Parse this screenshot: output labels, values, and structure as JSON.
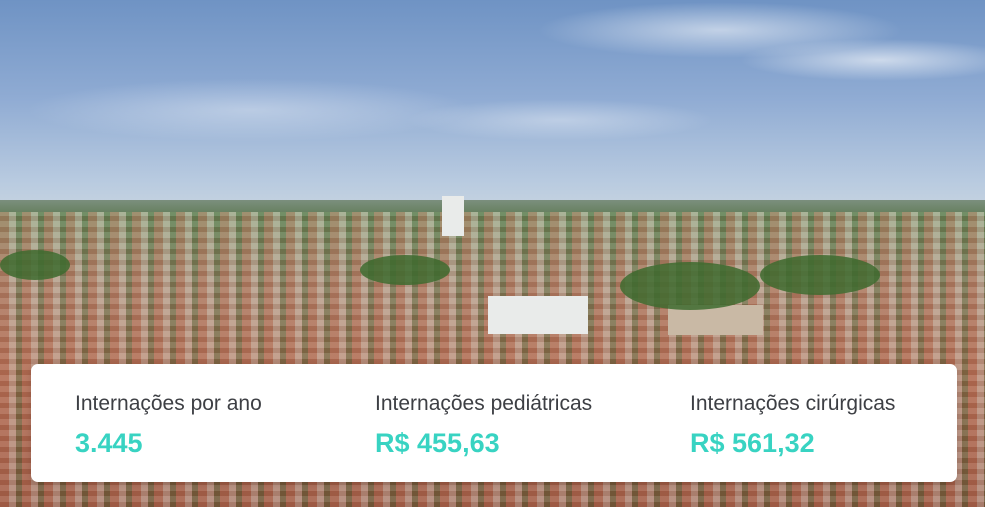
{
  "stats": [
    {
      "label": "Internações por ano",
      "value": "3.445"
    },
    {
      "label": "Internações pediátricas",
      "value": "R$ 455,63"
    },
    {
      "label": "Internações cirúrgicas",
      "value": "R$ 561,32"
    }
  ],
  "colors": {
    "accent": "#38d3c2",
    "label": "#3d3f44",
    "card": "#ffffff"
  }
}
